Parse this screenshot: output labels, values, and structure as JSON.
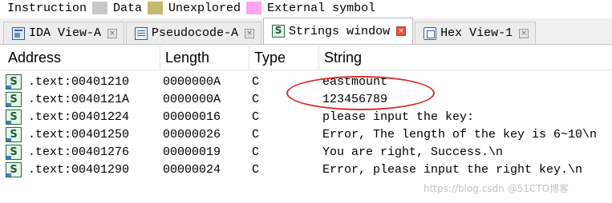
{
  "legend": {
    "items": [
      {
        "label": "Instruction",
        "color": "#ffffff"
      },
      {
        "label": "Data",
        "color": "#c8c8c8"
      },
      {
        "label": "Unexplored",
        "color": "#c7b86c"
      },
      {
        "label": "External symbol",
        "color": "#ffa4f0"
      }
    ]
  },
  "tabs": [
    {
      "label": "IDA View-A",
      "icon": "ida-view-icon",
      "active": false
    },
    {
      "label": "Pseudocode-A",
      "icon": "pseudocode-icon",
      "active": false
    },
    {
      "label": "Strings window",
      "icon": "strings-icon",
      "active": true
    },
    {
      "label": "Hex View-1",
      "icon": "hex-view-icon",
      "active": false
    }
  ],
  "table": {
    "columns": [
      "Address",
      "Length",
      "Type",
      "String"
    ],
    "row_icon_glyph": "S",
    "rows": [
      {
        "address": ".text:00401210",
        "length": "0000000A",
        "type": "C",
        "string": "eastmount"
      },
      {
        "address": ".text:0040121A",
        "length": "0000000A",
        "type": "C",
        "string": "123456789"
      },
      {
        "address": ".text:00401224",
        "length": "00000016",
        "type": "C",
        "string": "please input the key:"
      },
      {
        "address": ".text:00401250",
        "length": "00000026",
        "type": "C",
        "string": "Error, The length of the key is 6~10\\n"
      },
      {
        "address": ".text:00401276",
        "length": "00000019",
        "type": "C",
        "string": "You are right, Success.\\n"
      },
      {
        "address": ".text:00401290",
        "length": "00000024",
        "type": "C",
        "string": "Error, please input the right key.\\n"
      }
    ]
  },
  "watermark": "https://blog.csdn @51CTO博客"
}
